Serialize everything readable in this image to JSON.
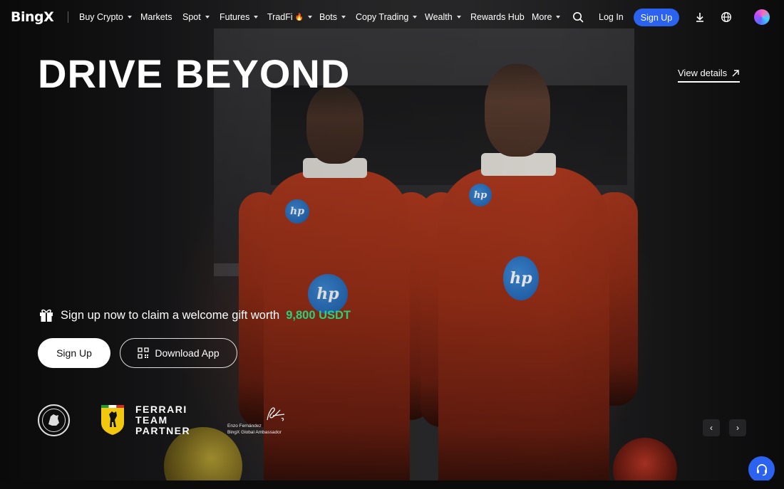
{
  "nav": {
    "logo": "BingX",
    "items": [
      {
        "label": "Buy Crypto",
        "dropdown": true
      },
      {
        "label": "Markets",
        "dropdown": false
      },
      {
        "label": "Spot",
        "dropdown": true
      },
      {
        "label": "Futures",
        "dropdown": true
      },
      {
        "label": "TradFi",
        "dropdown": true,
        "badge": "🔥"
      },
      {
        "label": "Bots",
        "dropdown": true
      },
      {
        "label": "Copy Trading",
        "dropdown": true
      },
      {
        "label": "Wealth",
        "dropdown": true
      },
      {
        "label": "Rewards Hub",
        "dropdown": false
      },
      {
        "label": "More",
        "dropdown": true
      }
    ],
    "icons": [
      "search-icon",
      "download-icon",
      "globe-icon"
    ],
    "login_label": "Log In",
    "signup_label": "Sign Up"
  },
  "hero": {
    "headline": "DRIVE BEYOND",
    "view_details_label": "View details",
    "promo_text": "Sign up now to claim a welcome gift worth",
    "promo_amount": "9,800 USDT",
    "signup_label": "Sign Up",
    "download_label": "Download App",
    "suit_logos": {
      "hp": "hp"
    }
  },
  "partners": {
    "chelsea": "CHELSEA FOOTBALL CLUB",
    "ferrari_lines": [
      "FERRARI",
      "TEAM",
      "PARTNER"
    ],
    "ambassador_name": "Enzo Fernández",
    "ambassador_role": "BingX Global Ambassador"
  },
  "carousel": {
    "prev": "‹",
    "next": "›"
  },
  "colors": {
    "accent": "#2b62f0",
    "promo_amount": "#2bd07a"
  }
}
